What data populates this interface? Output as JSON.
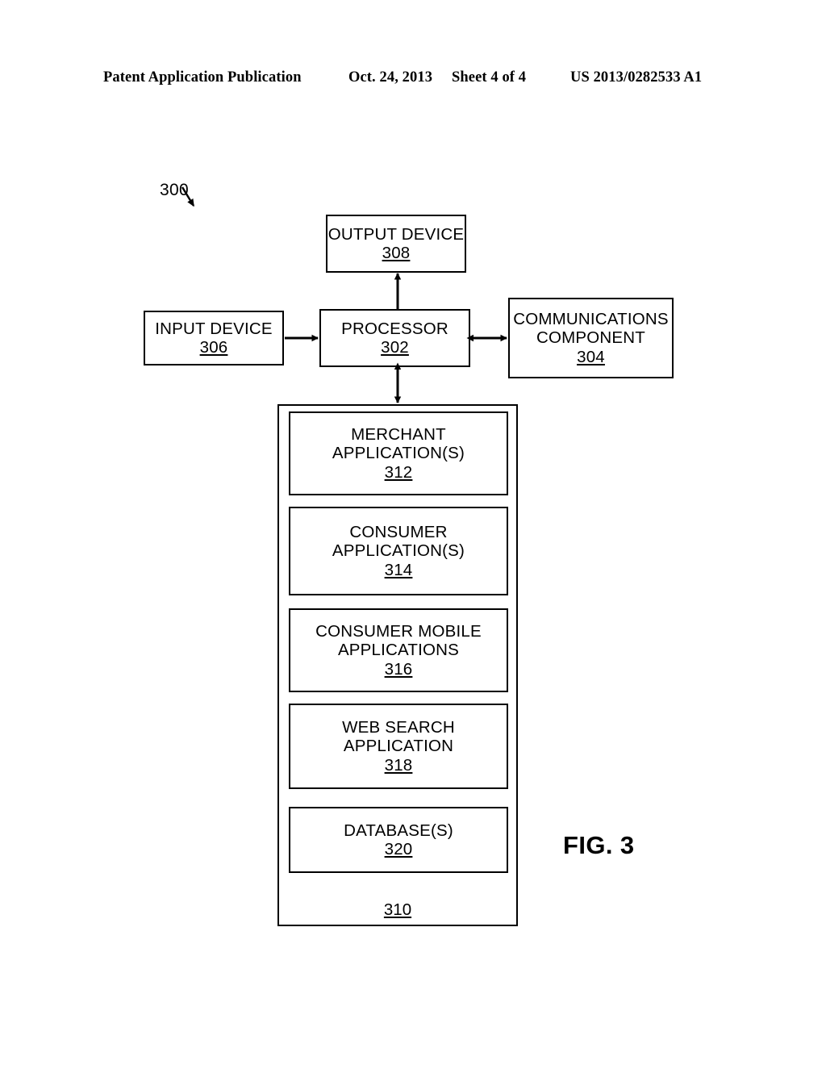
{
  "header": {
    "publication": "Patent Application Publication",
    "date": "Oct. 24, 2013",
    "sheet": "Sheet 4 of 4",
    "patent_number": "US 2013/0282533 A1"
  },
  "figure": {
    "figure_label": "FIG. 3",
    "system_ref": "300",
    "container_ref": "310",
    "blocks": {
      "output_device": {
        "line1": "OUTPUT DEVICE",
        "ref": "308"
      },
      "input_device": {
        "line1": "INPUT DEVICE",
        "ref": "306"
      },
      "processor": {
        "line1": "PROCESSOR",
        "ref": "302"
      },
      "communications": {
        "line1": "COMMUNICATIONS",
        "line2": "COMPONENT",
        "ref": "304"
      },
      "merchant_applications": {
        "line1": "MERCHANT",
        "line2": "APPLICATION(S)",
        "ref": "312"
      },
      "consumer_applications": {
        "line1": "CONSUMER",
        "line2": "APPLICATION(S)",
        "ref": "314"
      },
      "consumer_mobile_applications": {
        "line1": "CONSUMER MOBILE",
        "line2": "APPLICATIONS",
        "ref": "316"
      },
      "web_search_application": {
        "line1": "WEB SEARCH",
        "line2": "APPLICATION",
        "ref": "318"
      },
      "databases": {
        "line1": "DATABASE(S)",
        "ref": "320"
      }
    },
    "connectors": [
      {
        "name": "processor-to-output-device",
        "style": "single-arrow-up"
      },
      {
        "name": "input-device-to-processor",
        "style": "single-arrow-right"
      },
      {
        "name": "processor-to-communications",
        "style": "double-arrow-horizontal"
      },
      {
        "name": "processor-to-memory",
        "style": "double-arrow-vertical"
      },
      {
        "name": "system-leader-line",
        "style": "diagonal-arrow"
      }
    ],
    "colors": {
      "stroke": "#000000",
      "background": "#ffffff"
    }
  }
}
